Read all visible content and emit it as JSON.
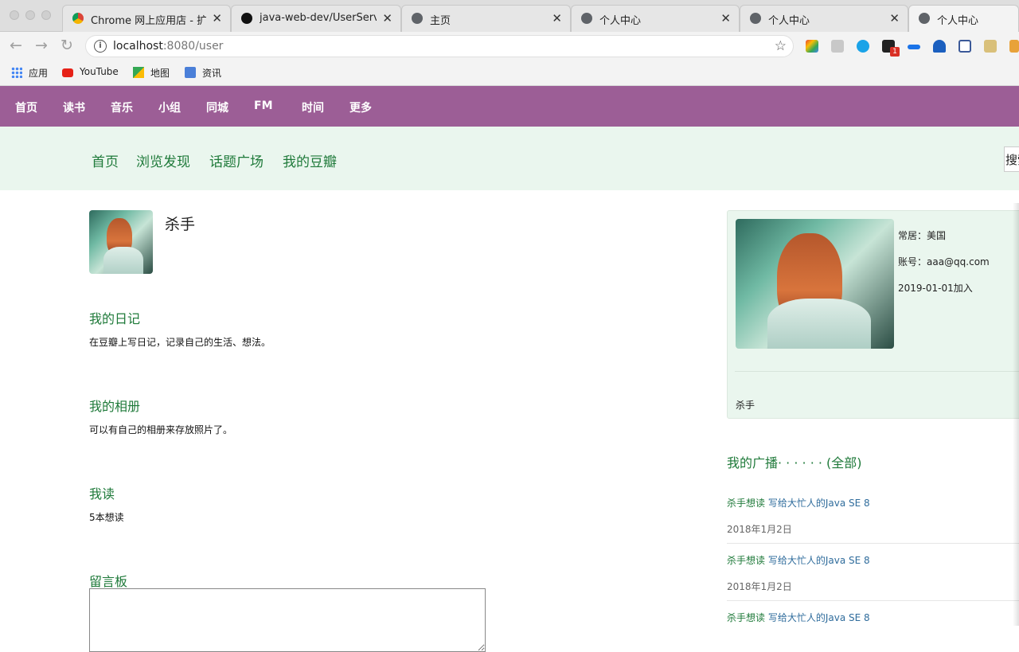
{
  "browser": {
    "tabs": [
      {
        "label": "Chrome 网上应用店 - 扩展程序",
        "icon": "chrome-store-icon"
      },
      {
        "label": "java-web-dev/UserService",
        "icon": "github-icon"
      },
      {
        "label": "主页",
        "icon": "globe-icon"
      },
      {
        "label": "个人中心",
        "icon": "globe-icon"
      },
      {
        "label": "个人中心",
        "icon": "globe-icon"
      },
      {
        "label": "个人中心",
        "icon": "globe-icon",
        "active": true
      }
    ],
    "url_host": "localhost",
    "url_path": ":8080/user",
    "extension_badge": "1",
    "bookmarks": [
      {
        "label": "应用",
        "icon": "apps-grid-icon"
      },
      {
        "label": "YouTube",
        "icon": "youtube-icon"
      },
      {
        "label": "地图",
        "icon": "maps-icon"
      },
      {
        "label": "资讯",
        "icon": "news-icon"
      }
    ]
  },
  "topnav": {
    "items": [
      "首页",
      "读书",
      "音乐",
      "小组",
      "同城",
      "FM",
      "时间",
      "更多"
    ],
    "color": "#9c5e96"
  },
  "subnav": {
    "items": [
      "首页",
      "浏览发现",
      "话题广场",
      "我的豆瓣"
    ],
    "search_label": "搜索"
  },
  "profile": {
    "username": "杀手",
    "sections": [
      {
        "title": "我的日记",
        "desc": "在豆瓣上写日记，记录自己的生活、想法。"
      },
      {
        "title": "我的相册",
        "desc": "可以有自己的相册来存放照片了。"
      },
      {
        "title": "我读",
        "desc": "5本想读"
      },
      {
        "title": "留言板",
        "desc": ""
      }
    ]
  },
  "card": {
    "residence": "常居：美国",
    "account": "账号：aaa@qq.com",
    "joined": "2019-01-01加入",
    "name": "杀手"
  },
  "broadcast": {
    "title": "我的广播· · · · · · (全部)",
    "items": [
      {
        "who": "杀手想读",
        "book": "写给大忙人的Java SE 8",
        "date": "2018年1月2日"
      },
      {
        "who": "杀手想读",
        "book": "写给大忙人的Java SE 8",
        "date": "2018年1月2日"
      },
      {
        "who": "杀手想读",
        "book": "写给大忙人的Java SE 8",
        "date": ""
      }
    ]
  },
  "colors": {
    "accent_green": "#1f7a3a",
    "subnav_bg": "#eaf6ee",
    "link_blue": "#2f6c9c"
  }
}
